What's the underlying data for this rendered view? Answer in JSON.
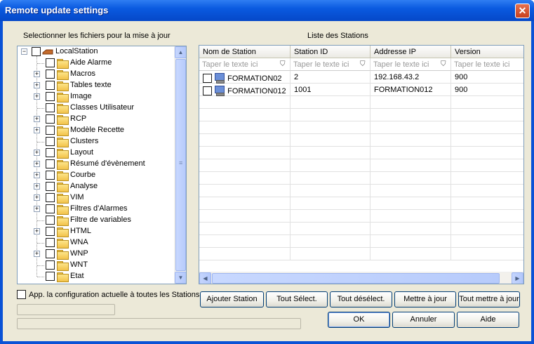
{
  "window": {
    "title": "Remote update settings",
    "close_label": "✕"
  },
  "left_panel": {
    "title": "Selectionner les fichiers pour la mise à jour",
    "root": {
      "label": "LocalStation",
      "expander": "−"
    },
    "items": [
      {
        "label": "Aide Alarme",
        "expandable": false
      },
      {
        "label": "Macros",
        "expandable": true
      },
      {
        "label": "Tables texte",
        "expandable": true
      },
      {
        "label": "Image",
        "expandable": true
      },
      {
        "label": "Classes Utilisateur",
        "expandable": false
      },
      {
        "label": "RCP",
        "expandable": true
      },
      {
        "label": "Modèle Recette",
        "expandable": true
      },
      {
        "label": "Clusters",
        "expandable": false
      },
      {
        "label": "Layout",
        "expandable": true
      },
      {
        "label": "Résumé d'évènement",
        "expandable": true
      },
      {
        "label": "Courbe",
        "expandable": true
      },
      {
        "label": "Analyse",
        "expandable": true
      },
      {
        "label": "VIM",
        "expandable": true
      },
      {
        "label": "Filtres d'Alarmes",
        "expandable": true
      },
      {
        "label": "Filtre de variables",
        "expandable": false
      },
      {
        "label": "HTML",
        "expandable": true
      },
      {
        "label": "WNA",
        "expandable": false
      },
      {
        "label": "WNP",
        "expandable": true
      },
      {
        "label": "WNT",
        "expandable": false
      },
      {
        "label": "Etat",
        "expandable": false
      }
    ],
    "apply_all_label": "App. la configuration actuelle à toutes les Stations"
  },
  "right_panel": {
    "title": "Liste des Stations",
    "columns": [
      "Nom de Station",
      "Station ID",
      "Addresse IP",
      "Version"
    ],
    "filter_placeholder": "Taper le texte ici",
    "rows": [
      {
        "name": "FORMATION02",
        "id": "2",
        "ip": "192.168.43.2",
        "version": "900"
      },
      {
        "name": "FORMATION012",
        "id": "1001",
        "ip": "FORMATION012",
        "version": "900"
      }
    ]
  },
  "buttons": {
    "add_station": "Ajouter Station",
    "select_all": "Tout Sélect.",
    "deselect_all": "Tout désélect.",
    "update": "Mettre à jour",
    "update_all": "Tout mettre à jour",
    "ok": "OK",
    "cancel": "Annuler",
    "help": "Aide"
  },
  "scroll_arrows": {
    "up": "▲",
    "down": "▼",
    "left": "◀",
    "right": "▶",
    "grip": "≡"
  }
}
